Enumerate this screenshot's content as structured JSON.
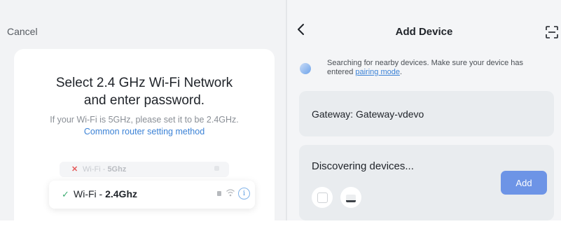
{
  "left": {
    "cancel_label": "Cancel",
    "title_line1": "Select 2.4 GHz Wi-Fi Network",
    "title_line2": "and enter password.",
    "subtitle": "If your Wi-Fi is 5GHz, please set it to be 2.4GHz.",
    "link": "Common router setting method",
    "wifi_bad": {
      "prefix": "Wi-Fi - ",
      "band": "5Ghz",
      "status_icon": "cross-icon"
    },
    "wifi_good": {
      "prefix": "Wi-Fi - ",
      "band": "2.4Ghz",
      "status_icon": "checkmark-icon",
      "info_glyph": "i"
    }
  },
  "right": {
    "title": "Add Device",
    "hint_text": "Searching for nearby devices. Make sure your device has entered ",
    "hint_link": "pairing mode",
    "hint_end": ".",
    "gateway_label": "Gateway: Gateway-vdevo",
    "discovering_label": "Discovering devices...",
    "add_label": "Add"
  },
  "colors": {
    "accent": "#6d94e6",
    "link": "#3b82d6",
    "success": "#3fae73",
    "error": "#e55b5b"
  }
}
